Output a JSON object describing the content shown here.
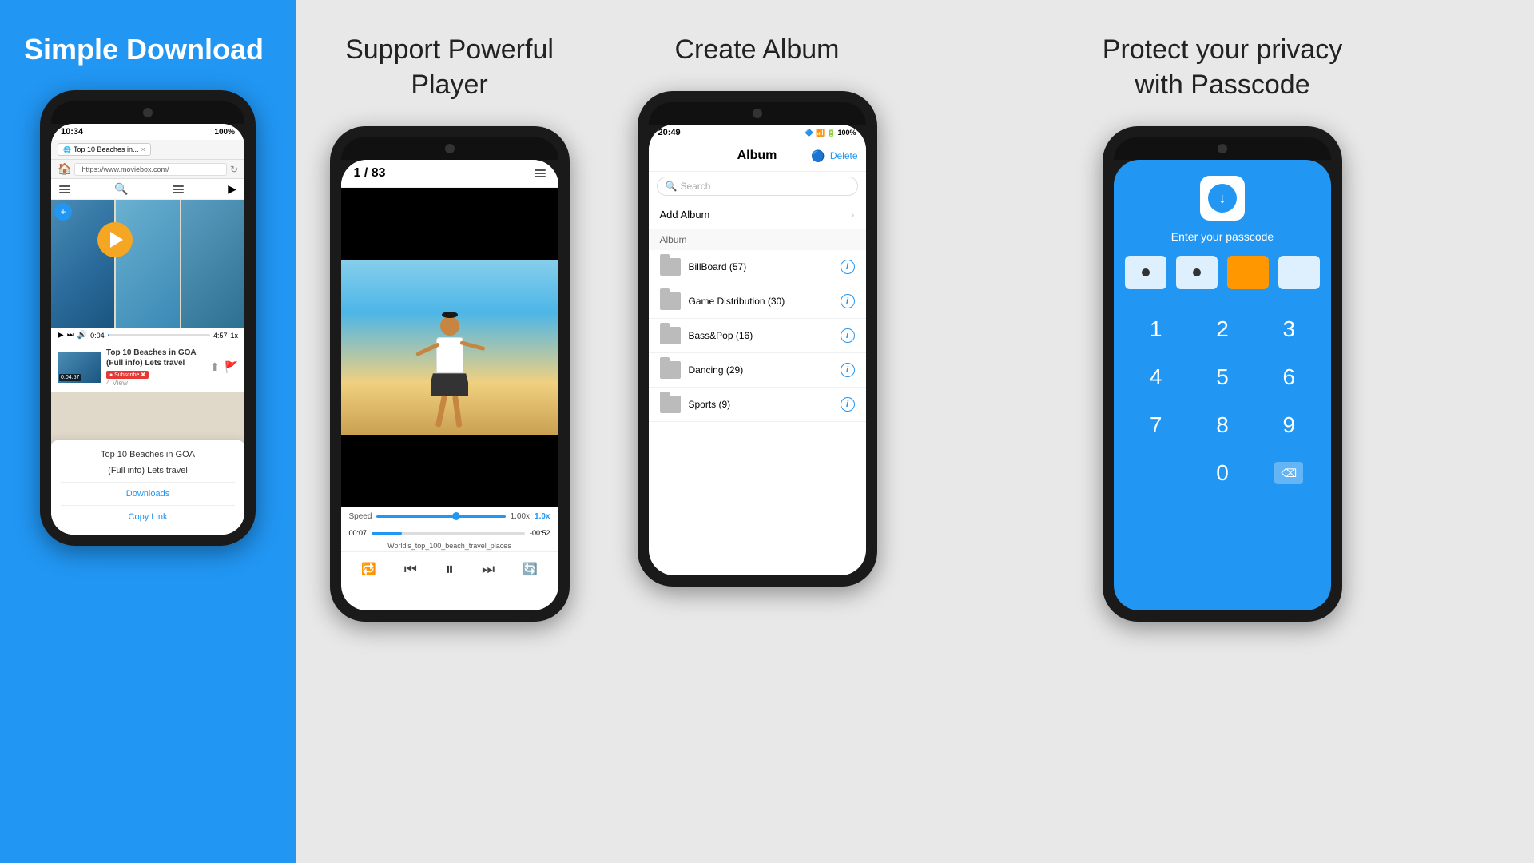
{
  "section1": {
    "title": "Simple Download",
    "phone": {
      "status_time": "10:34",
      "status_battery": "100%",
      "browser_tab": "Top 10 Beaches in...",
      "browser_url": "https://www.moviebox.com/",
      "video_duration": "0:04",
      "video_total": "4:57",
      "speed_label": "1x",
      "video_title": "Top 10 Beaches in GOA (Full info) Lets travel",
      "duration_badge": "0:04:57",
      "views": "4 View",
      "share_title_line1": "Top 10 Beaches in GOA",
      "share_title_line2": "(Full info) Lets travel",
      "downloads_label": "Downloads",
      "copy_link_label": "Copy Link"
    }
  },
  "section2": {
    "title_line1": "Support Powerful",
    "title_line2": "Player",
    "phone": {
      "counter": "1 / 83",
      "speed_label": "Speed",
      "speed_value": "1.00x",
      "speed_highlight": "1.0x",
      "time_current": "00:07",
      "time_remaining": "-00:52",
      "filename": "World's_top_100_beach_travel_places"
    }
  },
  "section3": {
    "title": "Create Album",
    "phone": {
      "status_time": "20:49",
      "status_battery": "100%",
      "header_title": "Album",
      "delete_label": "Delete",
      "search_placeholder": "Search",
      "add_album_label": "Add Album",
      "album_section_label": "Album",
      "albums": [
        {
          "name": "BillBoard (57)"
        },
        {
          "name": "Game Distribution (30)"
        },
        {
          "name": "Bass&Pop (16)"
        },
        {
          "name": "Dancing (29)"
        },
        {
          "name": "Sports (9)"
        }
      ]
    }
  },
  "section4": {
    "title_line1": "Protect your privacy",
    "title_line2": "with Passcode",
    "phone": {
      "prompt": "Enter your passcode",
      "digits": [
        "•",
        "•",
        "",
        ""
      ],
      "numpad": [
        "1",
        "2",
        "3",
        "4",
        "5",
        "6",
        "7",
        "8",
        "9",
        "0"
      ]
    }
  }
}
